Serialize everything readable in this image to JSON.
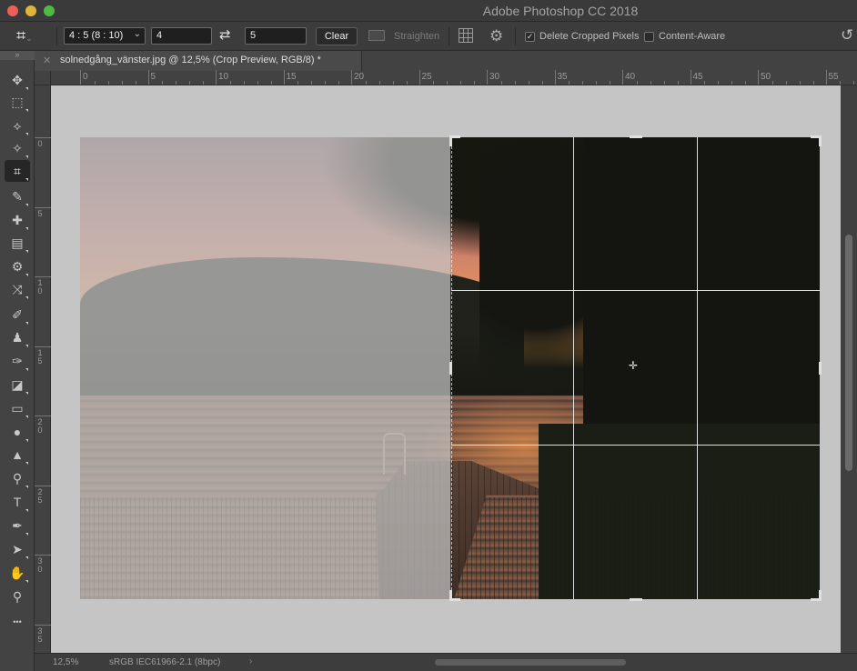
{
  "window": {
    "title": "Adobe Photoshop CC 2018"
  },
  "options_bar": {
    "ratio_preset": "4 : 5 (8 : 10)",
    "width_value": "4",
    "height_value": "5",
    "clear_label": "Clear",
    "straighten_label": "Straighten",
    "delete_cropped_label": "Delete Cropped Pixels",
    "delete_cropped_checked": true,
    "content_aware_label": "Content-Aware",
    "content_aware_checked": false
  },
  "document_tab": {
    "title": "solnedgång_vänster.jpg @ 12,5% (Crop Preview, RGB/8) *"
  },
  "ruler": {
    "horizontal_labels": [
      "0",
      "5",
      "10",
      "15",
      "20",
      "25",
      "30",
      "35",
      "40",
      "45",
      "50",
      "55"
    ],
    "vertical_labels": [
      "0",
      "5",
      "10",
      "15",
      "20",
      "25",
      "30",
      "35"
    ]
  },
  "tools": [
    {
      "name": "move-tool",
      "icon": "move-icon",
      "glyph": "✥"
    },
    {
      "name": "marquee-tool",
      "icon": "rect-marquee-icon",
      "glyph": "⬚"
    },
    {
      "name": "lasso-tool",
      "icon": "polygonal-lasso-icon",
      "glyph": "⟡"
    },
    {
      "name": "magic-wand-tool",
      "icon": "magic-wand-icon",
      "glyph": "✧"
    },
    {
      "name": "crop-tool",
      "icon": "crop-icon",
      "glyph": "⌗",
      "active": true
    },
    {
      "name": "eyedropper-tool",
      "icon": "eyedropper-icon",
      "glyph": "✎"
    },
    {
      "name": "healing-tool",
      "icon": "bandage-icon",
      "glyph": "✚"
    },
    {
      "name": "patch-tool",
      "icon": "patch-icon",
      "glyph": "▤"
    },
    {
      "name": "transform-tool",
      "icon": "content-aware-move-icon",
      "glyph": "⚙"
    },
    {
      "name": "shuffle-tool",
      "icon": "shuffle-icon",
      "glyph": "⤨"
    },
    {
      "name": "brush-tool",
      "icon": "brush-icon",
      "glyph": "✐"
    },
    {
      "name": "stamp-tool",
      "icon": "stamp-icon",
      "glyph": "♟"
    },
    {
      "name": "history-brush-tool",
      "icon": "history-brush-icon",
      "glyph": "✑"
    },
    {
      "name": "eraser-tool",
      "icon": "eraser-icon",
      "glyph": "◪"
    },
    {
      "name": "gradient-tool",
      "icon": "gradient-icon",
      "glyph": "▭"
    },
    {
      "name": "blur-tool",
      "icon": "drop-icon",
      "glyph": "●"
    },
    {
      "name": "sharpen-tool",
      "icon": "sharpen-icon",
      "glyph": "▲"
    },
    {
      "name": "dodge-tool",
      "icon": "dodge-icon",
      "glyph": "⚲"
    },
    {
      "name": "type-tool",
      "icon": "type-icon",
      "glyph": "T"
    },
    {
      "name": "pen-tool",
      "icon": "pen-icon",
      "glyph": "✒"
    },
    {
      "name": "path-select-tool",
      "icon": "arrow-icon",
      "glyph": "➤"
    },
    {
      "name": "hand-tool",
      "icon": "hand-icon",
      "glyph": "✋"
    },
    {
      "name": "zoom-tool",
      "icon": "zoom-icon",
      "glyph": "⚲"
    },
    {
      "name": "more-tools",
      "icon": "ellipsis-icon",
      "glyph": "•••"
    }
  ],
  "status_bar": {
    "zoom": "12,5%",
    "profile": "sRGB IEC61966-2.1 (8bpc)"
  }
}
